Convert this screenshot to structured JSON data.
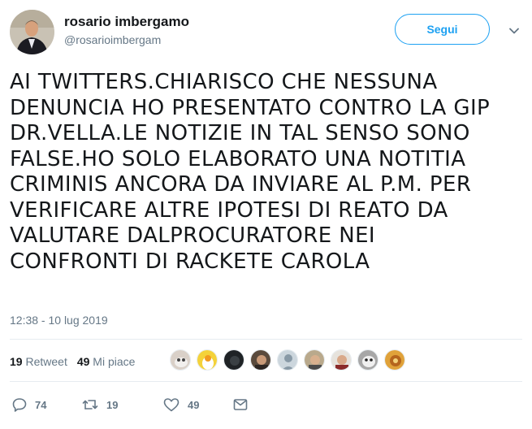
{
  "user": {
    "display_name": "rosario imbergamo",
    "handle": "@rosarioimbergam"
  },
  "follow_label": "Segui",
  "tweet_text": "AI TWITTERS.CHIARISCO CHE NESSUNA\nDENUNCIA HO PRESENTATO CONTRO LA  GIP\nDR.VELLA.LE NOTIZIE IN TAL SENSO SONO\nFALSE.HO SOLO ELABORATO UNA  NOTITIA\nCRIMINIS ANCORA  DA INVIARE AL P.M. PER\nVERIFICARE ALTRE IPOTESI DI REATO DA\nVALUTARE DALPROCURATORE NEI\nCONFRONTI DI RACKETE CAROLA",
  "timestamp": "12:38 - 10 lug 2019",
  "stats": {
    "retweets_count": "19",
    "retweets_label": "Retweet",
    "likes_count": "49",
    "likes_label": "Mi piace"
  },
  "actions": {
    "reply_count": "74",
    "retweet_count": "19",
    "like_count": "49"
  },
  "colors": {
    "accent": "#1da1f2",
    "secondary_text": "#657786",
    "divider": "#e6ecf0"
  },
  "icons": [
    "chevron-down-icon",
    "reply-icon",
    "retweet-icon",
    "heart-icon",
    "envelope-icon"
  ]
}
